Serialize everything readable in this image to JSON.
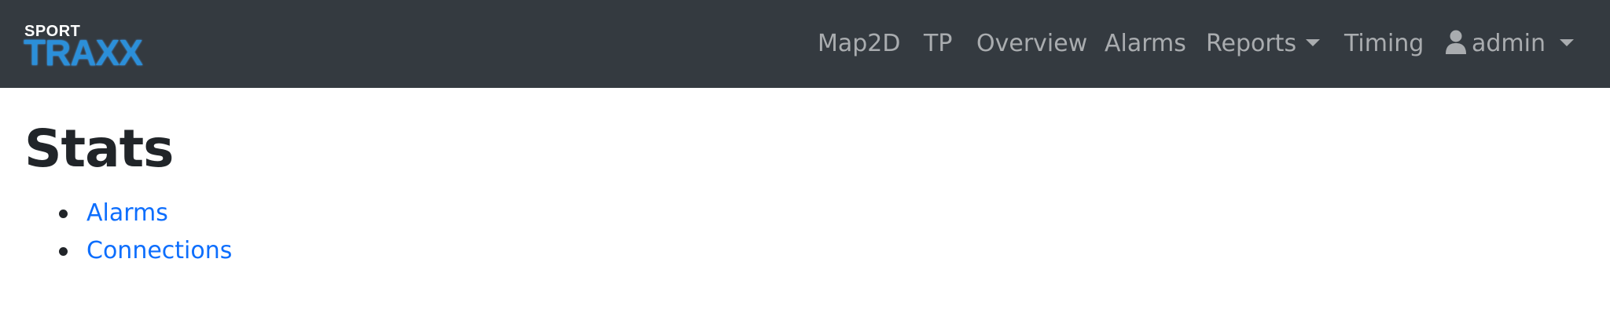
{
  "navbar": {
    "brand": {
      "top_text": "SPORT",
      "main_text": "TRAXX"
    },
    "items": [
      {
        "label": "Map2D"
      },
      {
        "label": "TP"
      },
      {
        "label": "Overview"
      },
      {
        "label": "Alarms"
      },
      {
        "label": "Reports",
        "dropdown": true
      },
      {
        "label": "Timing"
      }
    ],
    "user": {
      "label": "admin",
      "icon": "user-icon",
      "dropdown": true
    },
    "colors": {
      "background": "#343a40",
      "text": "#9a9da0",
      "brand_blue": "#2b8fd9"
    }
  },
  "main": {
    "title": "Stats",
    "links": [
      {
        "label": "Alarms"
      },
      {
        "label": "Connections"
      }
    ],
    "colors": {
      "link": "#0d6efd",
      "title": "#212529"
    }
  }
}
